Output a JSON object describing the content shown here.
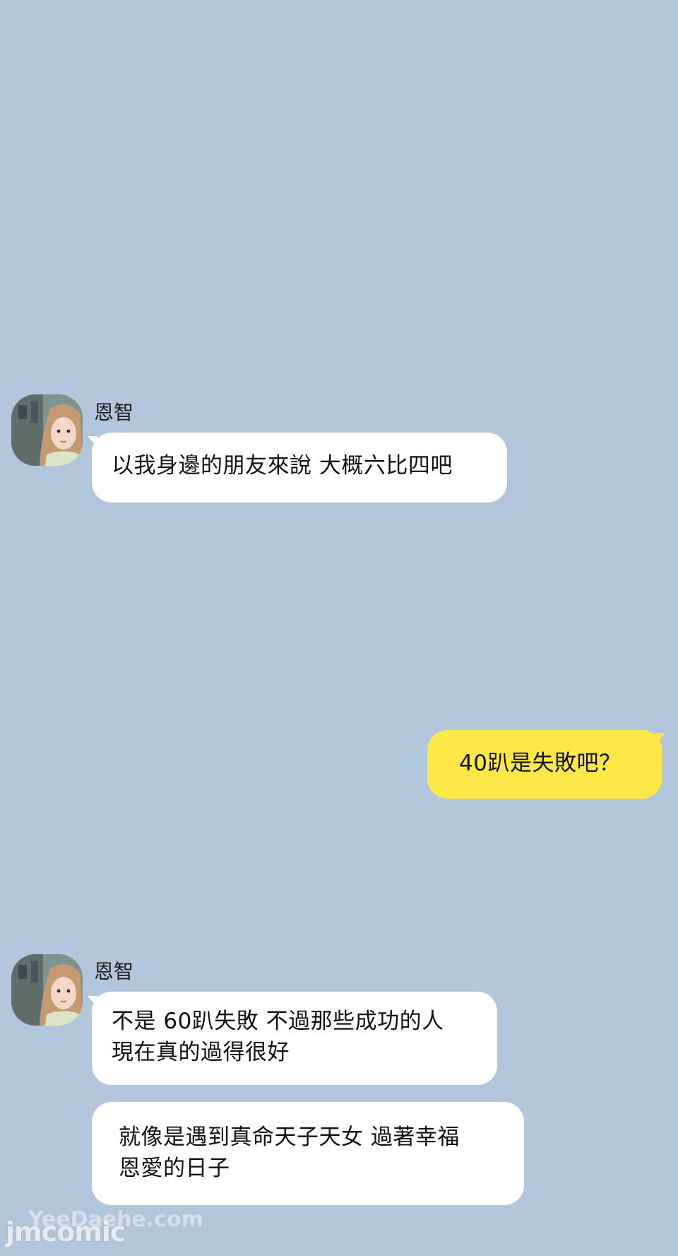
{
  "colors": {
    "background": "#b2c7dc",
    "incoming_bubble": "#ffffff",
    "outgoing_bubble": "#fde847"
  },
  "messages": [
    {
      "direction": "incoming",
      "sender": "恩智",
      "avatar_icon": "profile-avatar-icon",
      "lines": [
        "以我身邊的朋友來說 大概六比四吧"
      ]
    },
    {
      "direction": "outgoing",
      "lines": [
        "40趴是失敗吧？"
      ]
    },
    {
      "direction": "incoming",
      "sender": "恩智",
      "avatar_icon": "profile-avatar-icon",
      "lines": [
        "不是 60趴失敗 不過那些成功的人",
        "現在真的過得很好"
      ]
    },
    {
      "direction": "incoming",
      "lines": [
        "就像是遇到真命天子天女 過著幸福",
        "恩愛的日子"
      ]
    }
  ],
  "watermark": {
    "primary": "jmcomic",
    "secondary": "YeeDaehe.com"
  }
}
